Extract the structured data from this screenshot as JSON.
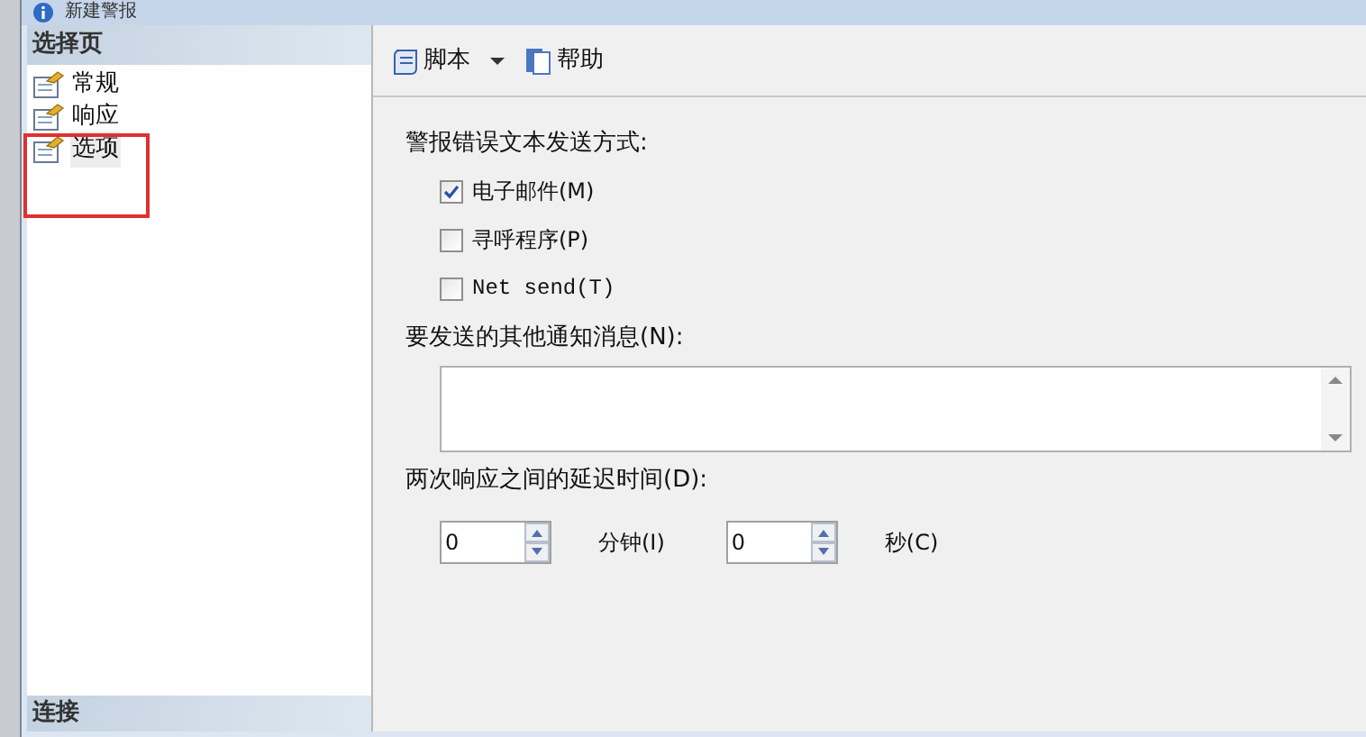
{
  "window": {
    "title": "新建警报"
  },
  "sidebar": {
    "header": "选择页",
    "items": [
      {
        "label": "常规",
        "selected": false
      },
      {
        "label": "响应",
        "selected": false
      },
      {
        "label": "选项",
        "selected": true
      }
    ],
    "footer": "连接"
  },
  "toolbar": {
    "script": "脚本",
    "help": "帮助"
  },
  "send_methods": {
    "label": "警报错误文本发送方式:",
    "options": [
      {
        "label": "电子邮件(M)",
        "checked": true
      },
      {
        "label": "寻呼程序(P)",
        "checked": false
      },
      {
        "label": "Net send(T)",
        "checked": false
      }
    ]
  },
  "notification": {
    "label": "要发送的其他通知消息(N):"
  },
  "delay": {
    "label": "两次响应之间的延迟时间(D):",
    "fields": [
      {
        "value": "0",
        "unit": "分钟(I)"
      },
      {
        "value": "0",
        "unit": "秒(C)"
      }
    ]
  }
}
